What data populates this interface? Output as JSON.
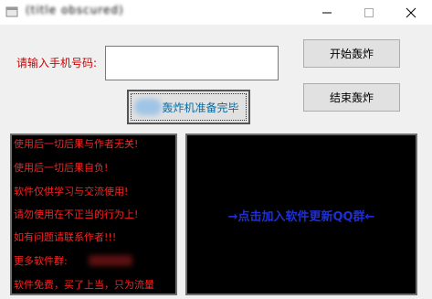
{
  "window": {
    "title": "(title obscured)",
    "controls": {
      "minimize": "—",
      "maximize": "☐",
      "close": "✕"
    }
  },
  "form": {
    "phone_label": "请输入手机号码:",
    "phone_value": "",
    "phone_placeholder": ""
  },
  "buttons": {
    "start": "开始轰炸",
    "stop": "结束轰炸",
    "ready": "轰炸机准备完毕"
  },
  "notice_lines": [
    "使用后一切后果与作者无关!",
    "使用后一切后果自负!",
    "软件仅供学习与交流使用!",
    "请勿使用在不正当的行为上!",
    "如有问题请联系作者!!!",
    "更多软件群:",
    "软件免费，买了上当，只为流量"
  ],
  "right_panel": {
    "link_text": "→点击加入软件更新QQ群←"
  },
  "colors": {
    "warning_text": "#ff2020",
    "link_text": "#1f2fd6",
    "label_red": "#cc0000",
    "panel_bg": "#000000"
  }
}
